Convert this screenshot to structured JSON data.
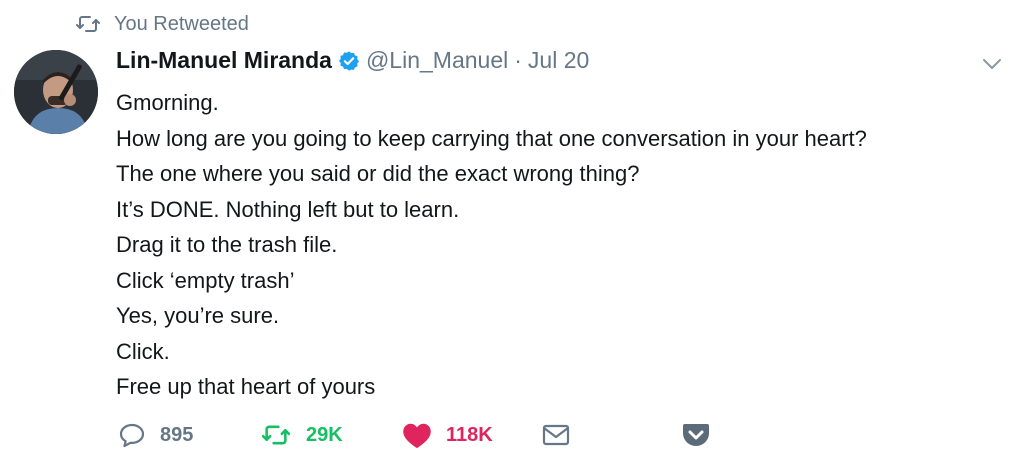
{
  "context": {
    "label": "You Retweeted",
    "icon": "retweet-icon"
  },
  "tweet": {
    "author_name": "Lin-Manuel Miranda",
    "verified": true,
    "handle": "@Lin_Manuel",
    "separator": "·",
    "date": "Jul 20",
    "lines": [
      "Gmorning.",
      "How long are you going to keep carrying that one conversation in your heart?",
      "The one where you said or did the exact wrong thing?",
      "It’s DONE. Nothing left but to learn.",
      "Drag it to the trash file.",
      "Click ‘empty trash’",
      "Yes, you’re sure.",
      "Click.",
      "Free up that heart of yours"
    ]
  },
  "actions": {
    "reply_count": "895",
    "retweet_count": "29K",
    "like_count": "118K"
  },
  "colors": {
    "verified": "#1da1f2",
    "retweet_active": "#17bf63",
    "like_active": "#e0245e",
    "muted": "#657786",
    "pocket": "#5b6b7a"
  }
}
